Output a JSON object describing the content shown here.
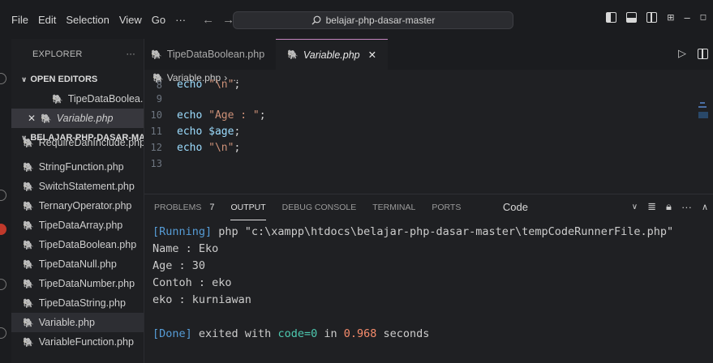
{
  "menu": [
    "File",
    "Edit",
    "Selection",
    "View",
    "Go",
    "···"
  ],
  "search": {
    "text": "belajar-php-dasar-master"
  },
  "explorer": {
    "title": "EXPLORER",
    "more": "···",
    "open_editors_label": "OPEN EDITORS",
    "open_editors": [
      {
        "name": "TipeDataBoolea..."
      },
      {
        "name": "Variable.php"
      }
    ],
    "project_label": "BELAJAR-PHP-DASAR-MA...",
    "files": [
      "RequireDanInclude.php",
      "StringFunction.php",
      "SwitchStatement.php",
      "TernaryOperator.php",
      "TipeDataArray.php",
      "TipeDataBoolean.php",
      "TipeDataNull.php",
      "TipeDataNumber.php",
      "TipeDataString.php",
      "Variable.php",
      "VariableFunction.php"
    ]
  },
  "tabs": [
    {
      "name": "TipeDataBoolean.php"
    },
    {
      "name": "Variable.php"
    }
  ],
  "breadcrumb": {
    "file": "Variable.php",
    "rest": "..."
  },
  "code": {
    "lines": [
      {
        "n": "8",
        "a": "echo ",
        "b": "\"\\n\"",
        "c": ";"
      },
      {
        "n": "9",
        "a": "",
        "b": "",
        "c": ""
      },
      {
        "n": "10",
        "a": "echo ",
        "b": "\"Age : \"",
        "c": ";"
      },
      {
        "n": "11",
        "a": "echo ",
        "b": "$age",
        "c": ";"
      },
      {
        "n": "12",
        "a": "echo ",
        "b": "\"\\n\"",
        "c": ";"
      },
      {
        "n": "13",
        "a": "",
        "b": "",
        "c": ""
      }
    ]
  },
  "panel": {
    "tabs": [
      "PROBLEMS",
      "OUTPUT",
      "DEBUG CONSOLE",
      "TERMINAL",
      "PORTS"
    ],
    "problems_count": "7",
    "select": "Code",
    "output": {
      "running_tag": "[Running]",
      "running_cmd": " php \"c:\\xampp\\htdocs\\belajar-php-dasar-master\\tempCodeRunnerFile.php\"",
      "lines": [
        "Name : Eko",
        "Age : 30",
        "Contoh : eko",
        "eko : kurniawan"
      ],
      "done_tag": "[Done]",
      "done_mid": " exited with ",
      "done_code": "code=0",
      "done_in": " in ",
      "done_time": "0.968",
      "done_end": " seconds"
    }
  },
  "colors": {
    "php_icon": "#a074c4",
    "accent": "#c586c0"
  }
}
